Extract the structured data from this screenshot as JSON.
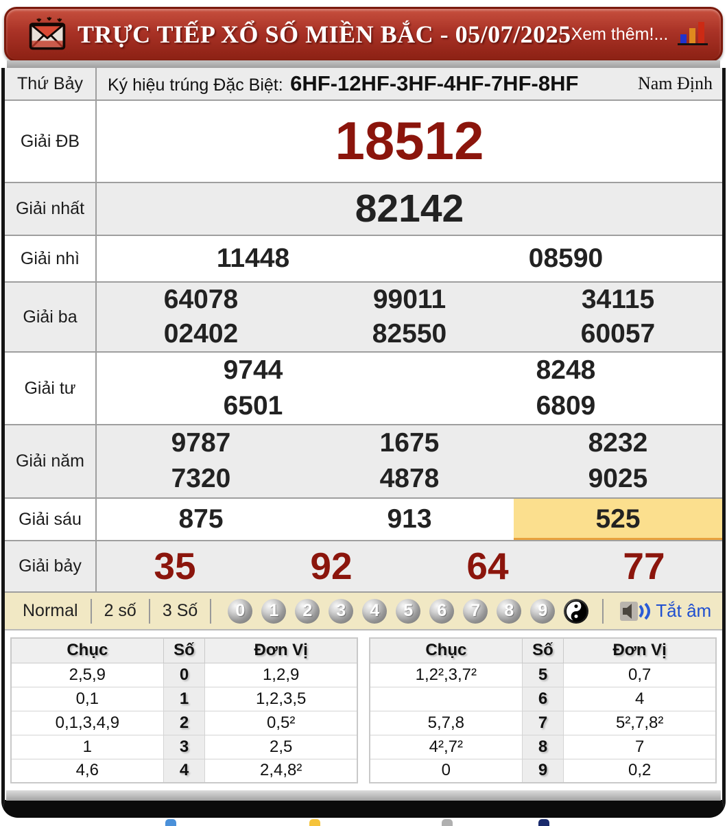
{
  "header": {
    "title": "TRỰC TIẾP XỔ SỐ MIỀN BẮC - 05/07/2025",
    "more_label": "Xem thêm!..."
  },
  "info_row": {
    "day": "Thứ Bảy",
    "symbol_label": "Ký hiệu trúng Đặc Biệt:",
    "symbol_value": "6HF-12HF-3HF-4HF-7HF-8HF",
    "province": "Nam Định"
  },
  "prizes": {
    "db": {
      "label": "Giải ĐB",
      "values": [
        "18512"
      ]
    },
    "nhat": {
      "label": "Giải nhất",
      "values": [
        "82142"
      ]
    },
    "nhi": {
      "label": "Giải nhì",
      "values": [
        "11448",
        "08590"
      ]
    },
    "ba": {
      "label": "Giải ba",
      "values": [
        "64078",
        "99011",
        "34115",
        "02402",
        "82550",
        "60057"
      ]
    },
    "tu": {
      "label": "Giải tư",
      "values": [
        "9744",
        "8248",
        "6501",
        "6809"
      ]
    },
    "nam": {
      "label": "Giải năm",
      "values": [
        "9787",
        "1675",
        "8232",
        "7320",
        "4878",
        "9025"
      ]
    },
    "sau": {
      "label": "Giải sáu",
      "values": [
        "875",
        "913",
        "525"
      ],
      "highlighted_value": "525"
    },
    "bay": {
      "label": "Giải bảy",
      "values": [
        "35",
        "92",
        "64",
        "77"
      ]
    }
  },
  "toolbar": {
    "modes": {
      "normal": "Normal",
      "two": "2 số",
      "three": "3 Số"
    },
    "balls": [
      "0",
      "1",
      "2",
      "3",
      "4",
      "5",
      "6",
      "7",
      "8",
      "9"
    ],
    "mute_label": "Tắt âm"
  },
  "stats": {
    "left": {
      "headers": [
        "Chục",
        "Số",
        "Đơn Vị"
      ],
      "rows": [
        [
          "2,5,9",
          "0",
          "1,2,9"
        ],
        [
          "0,1",
          "1",
          "1,2,3,5"
        ],
        [
          "0,1,3,4,9",
          "2",
          "0,5²"
        ],
        [
          "1",
          "3",
          "2,5"
        ],
        [
          "4,6",
          "4",
          "2,4,8²"
        ]
      ]
    },
    "right": {
      "headers": [
        "Chục",
        "Số",
        "Đơn Vị"
      ],
      "rows": [
        [
          "1,2²,3,7²",
          "5",
          "0,7"
        ],
        [
          "",
          "6",
          "4"
        ],
        [
          "5,7,8",
          "7",
          "5²,7,8²"
        ],
        [
          "4²,7²",
          "8",
          "7"
        ],
        [
          "0",
          "9",
          "0,2"
        ]
      ]
    }
  },
  "colors": {
    "header_red": "#a93226",
    "prize_red": "#8b150c",
    "highlight_yellow": "#fbdf8e",
    "toolbar_beige": "#f1e8c4",
    "mute_blue": "#1f4fd0"
  }
}
